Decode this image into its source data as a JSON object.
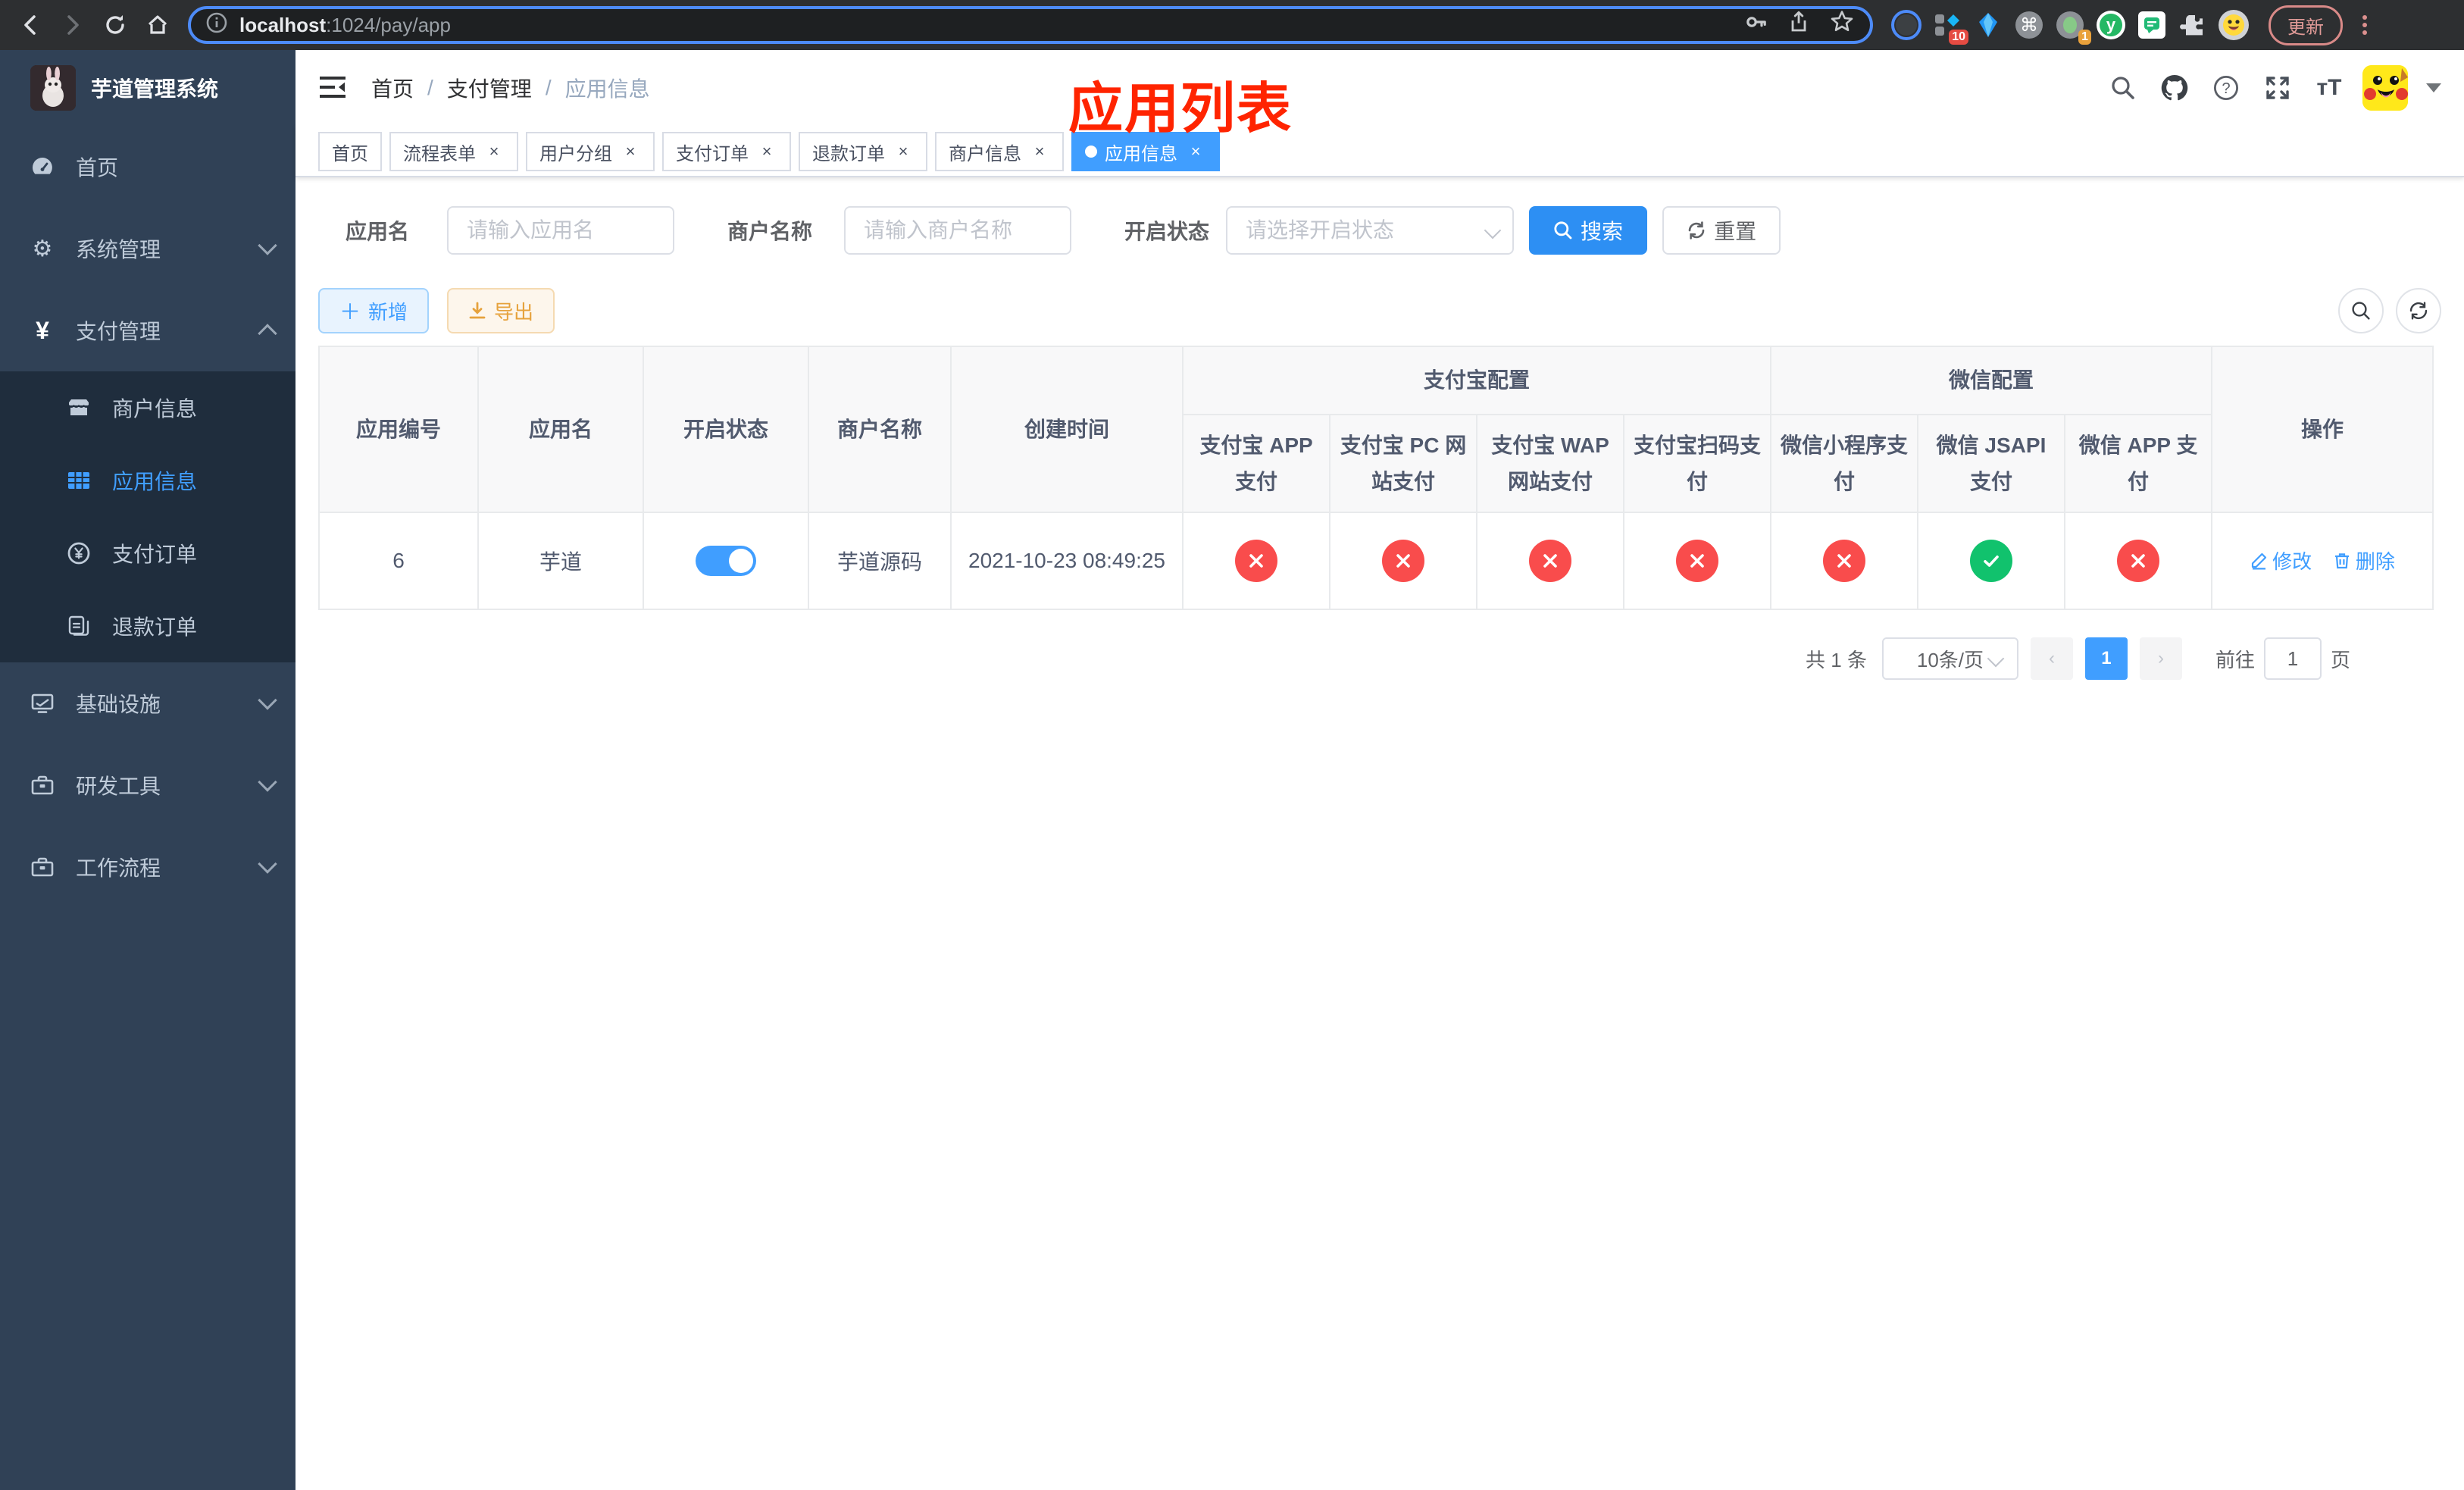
{
  "browser": {
    "url": {
      "host": "localhost",
      "path": ":1024/pay/app"
    },
    "update_label": "更新",
    "ext_badge_collection": "10",
    "ext_badge_recorder": "1"
  },
  "sidebar": {
    "title": "芋道管理系统",
    "items": [
      {
        "label": "首页"
      },
      {
        "label": "系统管理"
      },
      {
        "label": "支付管理"
      },
      {
        "label": "基础设施"
      },
      {
        "label": "研发工具"
      },
      {
        "label": "工作流程"
      }
    ],
    "submenu": [
      {
        "label": "商户信息"
      },
      {
        "label": "应用信息"
      },
      {
        "label": "支付订单"
      },
      {
        "label": "退款订单"
      }
    ]
  },
  "navbar": {
    "breadcrumb": [
      "首页",
      "支付管理",
      "应用信息"
    ]
  },
  "annotation": {
    "text": "应用列表",
    "color": "#ff2400"
  },
  "tabs": [
    {
      "label": "首页"
    },
    {
      "label": "流程表单"
    },
    {
      "label": "用户分组"
    },
    {
      "label": "支付订单"
    },
    {
      "label": "退款订单"
    },
    {
      "label": "商户信息"
    },
    {
      "label": "应用信息"
    }
  ],
  "filters": {
    "app_name_label": "应用名",
    "app_name_placeholder": "请输入应用名",
    "merchant_label": "商户名称",
    "merchant_placeholder": "请输入商户名称",
    "status_label": "开启状态",
    "status_placeholder": "请选择开启状态",
    "search_label": "搜索",
    "reset_label": "重置"
  },
  "toolbar": {
    "add_label": "新增",
    "export_label": "导出"
  },
  "table": {
    "group_headers": {
      "alipay": "支付宝配置",
      "wechat": "微信配置"
    },
    "columns": [
      "应用编号",
      "应用名",
      "开启状态",
      "商户名称",
      "创建时间",
      "支付宝 APP 支付",
      "支付宝 PC 网站支付",
      "支付宝 WAP 网站支付",
      "支付宝扫码支付",
      "微信小程序支付",
      "微信 JSAPI 支付",
      "微信 APP 支付",
      "操作"
    ],
    "row": {
      "id": "6",
      "name": "芋道",
      "enabled": true,
      "merchant": "芋道源码",
      "created_at": "2021-10-23 08:49:25",
      "pay_statuses": [
        false,
        false,
        false,
        false,
        false,
        true,
        false
      ],
      "edit_label": "修改",
      "delete_label": "删除"
    }
  },
  "pagination": {
    "total": "共 1 条",
    "page_size": "10条/页",
    "page": "1",
    "goto_label": "前往",
    "goto_value": "1",
    "unit_label": "页"
  },
  "colors": {
    "accent": "#409eff",
    "danger": "#f94c4c",
    "success": "#11c26d"
  }
}
